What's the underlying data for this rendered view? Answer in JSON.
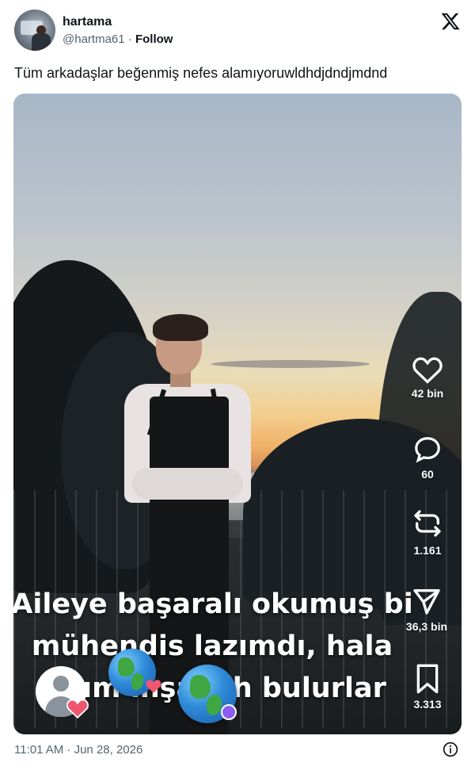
{
  "author": {
    "display_name": "hartama",
    "handle": "@hartma61",
    "separator": "·",
    "follow_label": "Follow"
  },
  "tweet": {
    "text": "Tüm arkadaşlar beğenmiş nefes alamıyoruwldhdjdndjmdnd"
  },
  "media": {
    "caption_lines": [
      "Aileye başaralı okumuş bi",
      "mühendis lazımdı, hala",
      "lazım inşallah bulurlar"
    ],
    "actions": {
      "likes": "42 bin",
      "comments": "60",
      "reposts": "1.161",
      "shares": "36,3 bin",
      "saves": "3.313"
    },
    "icons": [
      "heart-icon",
      "comment-icon",
      "repost-icon",
      "send-icon",
      "bookmark-icon"
    ]
  },
  "footer": {
    "timestamp": "11:01 AM · Jun 28, 2026"
  },
  "colors": {
    "text": "#0f1419",
    "secondary": "#536471",
    "overlay_text": "#ffffff"
  }
}
